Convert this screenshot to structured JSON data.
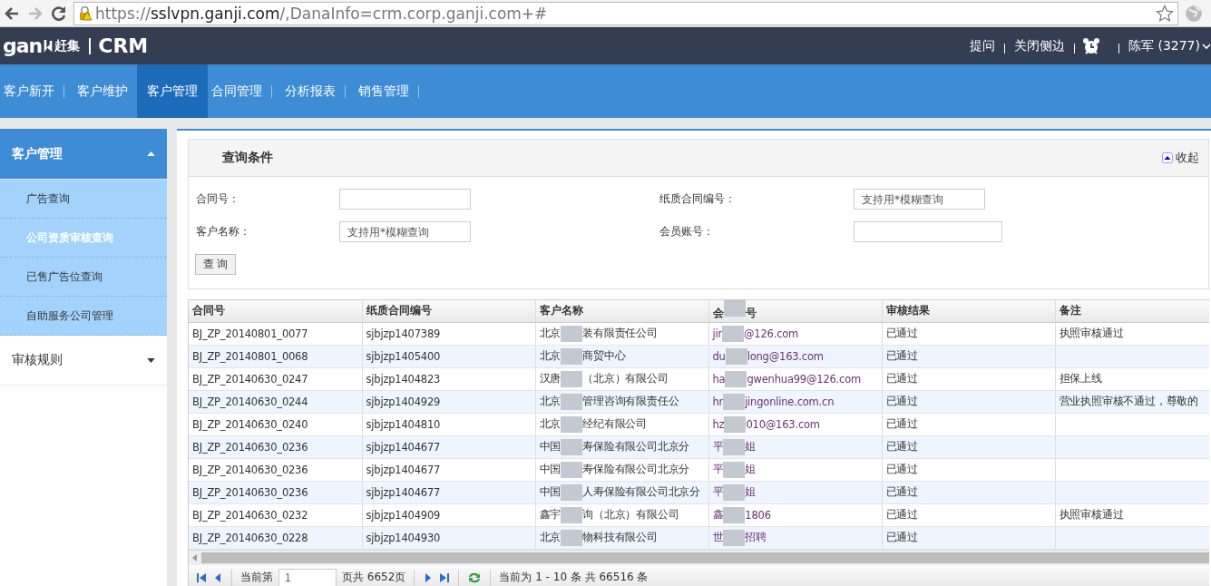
{
  "browser": {
    "back_disabled": false,
    "forward_disabled": true,
    "url": {
      "scheme": "https://",
      "host": "sslvpn.ganji.com",
      "rest": "/,DanaInfo=crm.corp.ganji.com+#"
    }
  },
  "header": {
    "logo": {
      "latin": "gan",
      "chinese": "赶集"
    },
    "product": "CRM",
    "links": [
      "提问",
      "关闭侧边"
    ],
    "user": "陈军 (3277)"
  },
  "nav": [
    {
      "label": "客户新开",
      "selected": false
    },
    {
      "label": "客户维护",
      "selected": false
    },
    {
      "label": "客户管理",
      "selected": true
    },
    {
      "label": "合同管理",
      "selected": false
    },
    {
      "label": "分析报表",
      "selected": false
    },
    {
      "label": "销售管理",
      "selected": false
    }
  ],
  "sidebar": [
    {
      "label": "客户管理",
      "expanded": true,
      "children": [
        {
          "label": "广告查询",
          "selected": false
        },
        {
          "label": "公司资质审核查询",
          "selected": true
        },
        {
          "label": "已售广告位查询",
          "selected": false
        },
        {
          "label": "自助服务公司管理",
          "selected": false
        }
      ]
    },
    {
      "label": "审核规则",
      "expanded": false
    }
  ],
  "query": {
    "title": "查询条件",
    "collapse": "收起",
    "fields": [
      {
        "label": "合同号："
      },
      {
        "label": "纸质合同编号：",
        "placeholder": "支持用*模糊查询"
      },
      {
        "label": "客户名称：",
        "placeholder": "支持用*模糊查询"
      },
      {
        "label": "会员账号："
      }
    ],
    "button": "查 询"
  },
  "table": {
    "columns": [
      {
        "before": "合同号"
      },
      {
        "before": "纸质合同编号"
      },
      {
        "before": "客户名称"
      },
      {
        "before": "会",
        "after": "号",
        "redacted": true
      },
      {
        "before": "审核结果"
      },
      {
        "before": "备注"
      }
    ],
    "rows": [
      [
        {
          "before": "BJ_ZP_20140801_0077"
        },
        {
          "before": "sjbjzp1407389"
        },
        {
          "before": "北京",
          "after": "装有限责任公司",
          "redacted": true
        },
        {
          "before": "jir",
          "after": "@126.com",
          "redacted": true
        },
        {
          "before": "已通过"
        },
        {
          "before": "执照审核通过"
        }
      ],
      [
        {
          "before": "BJ_ZP_20140801_0068"
        },
        {
          "before": "sjbjzp1405400"
        },
        {
          "before": "北京",
          "after": "商贸中心",
          "redacted": true
        },
        {
          "before": "du",
          "after": "long@163.com",
          "redacted": true
        },
        {
          "before": "已通过"
        },
        {}
      ],
      [
        {
          "before": "BJ_ZP_20140630_0247"
        },
        {
          "before": "sjbjzp1404823"
        },
        {
          "before": "汉唐",
          "after": "（北京）有限公司",
          "redacted": true
        },
        {
          "before": "ha",
          "after": "gwenhua99@126.com",
          "redacted": true
        },
        {
          "before": "已通过"
        },
        {
          "before": "担保上线"
        }
      ],
      [
        {
          "before": "BJ_ZP_20140630_0244"
        },
        {
          "before": "sjbjzp1404929"
        },
        {
          "before": "北京",
          "after": "管理咨询有限责任公",
          "redacted": true
        },
        {
          "before": "hr",
          "after": "jingonline.com.cn",
          "redacted": true
        },
        {
          "before": "已通过"
        },
        {
          "before": "营业执照审核不通过，尊敬的"
        }
      ],
      [
        {
          "before": "BJ_ZP_20140630_0240"
        },
        {
          "before": "sjbjzp1404810"
        },
        {
          "before": "北京",
          "after": "经纪有限公司",
          "redacted": true
        },
        {
          "before": "hz",
          "after": "010@163.com",
          "redacted": true
        },
        {
          "before": "已通过"
        }
      ],
      [
        {
          "before": "BJ_ZP_20140630_0236"
        },
        {
          "before": "sjbjzp1404677"
        },
        {
          "before": "中国",
          "after": "寿保险有限公司北京分",
          "redacted": true
        },
        {
          "before": "平",
          "after": "姐",
          "redacted": true
        },
        {
          "before": "已通过"
        }
      ],
      [
        {
          "before": "BJ_ZP_20140630_0236"
        },
        {
          "before": "sjbjzp1404677"
        },
        {
          "before": "中国",
          "after": "寿保险有限公司北京分",
          "redacted": true
        },
        {
          "before": "平",
          "after": "姐",
          "redacted": true
        },
        {
          "before": "已通过"
        }
      ],
      [
        {
          "before": "BJ_ZP_20140630_0236"
        },
        {
          "before": "sjbjzp1404677"
        },
        {
          "before": "中国",
          "after": "人寿保险有限公司北京分",
          "redacted": true
        },
        {
          "before": "平",
          "after": "姐",
          "redacted": true
        },
        {
          "before": "已通过"
        }
      ],
      [
        {
          "before": "BJ_ZP_20140630_0232"
        },
        {
          "before": "sjbjzp1404909"
        },
        {
          "before": "鑫宇",
          "after": "询（北京）有限公司",
          "redacted": true
        },
        {
          "before": "鑫",
          "after": "1806",
          "redacted": true
        },
        {
          "before": "已通过"
        },
        {
          "before": "执照审核通过"
        }
      ],
      [
        {
          "before": "BJ_ZP_20140630_0228"
        },
        {
          "before": "sjbjzp1404930"
        },
        {
          "before": "北京",
          "after": "物科技有限公司",
          "redacted": true
        },
        {
          "before": "世",
          "after": "招聘",
          "redacted": true
        },
        {
          "before": "已通过"
        },
        {}
      ]
    ]
  },
  "pager": {
    "before_page": "当前第",
    "page": "1",
    "total_pages": "页共 6652页",
    "summary": "当前为 1 - 10 条 共 66516 条"
  }
}
